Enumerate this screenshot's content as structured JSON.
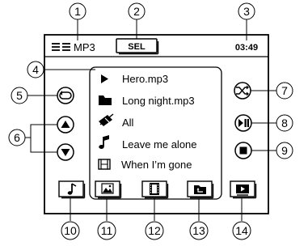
{
  "header": {
    "menu_icon": "menu-lines-icon",
    "mode": "MP3",
    "sel_label": "SEL",
    "time": "03:49"
  },
  "list": {
    "items": [
      {
        "icon": "play-triangle-icon",
        "label": "Hero.mp3"
      },
      {
        "icon": "folder-icon",
        "label": "Long night.mp3"
      },
      {
        "icon": "all-items-icon",
        "label": "All"
      },
      {
        "icon": "music-note-icon",
        "label": "Leave me alone"
      },
      {
        "icon": "video-film-icon",
        "label": "When I’m gone"
      }
    ]
  },
  "side_controls": {
    "left": [
      "repeat-icon",
      "scroll-up-icon",
      "scroll-down-icon"
    ],
    "right": [
      "shuffle-icon",
      "play-pause-icon",
      "stop-icon"
    ]
  },
  "bottom_bar": [
    "music-tab-icon",
    "photo-tab-icon",
    "video-tab-icon",
    "folder-up-tab-icon",
    "play-screen-tab-icon"
  ],
  "callouts": [
    "1",
    "2",
    "3",
    "4",
    "5",
    "6",
    "7",
    "8",
    "9",
    "10",
    "11",
    "12",
    "13",
    "14"
  ]
}
